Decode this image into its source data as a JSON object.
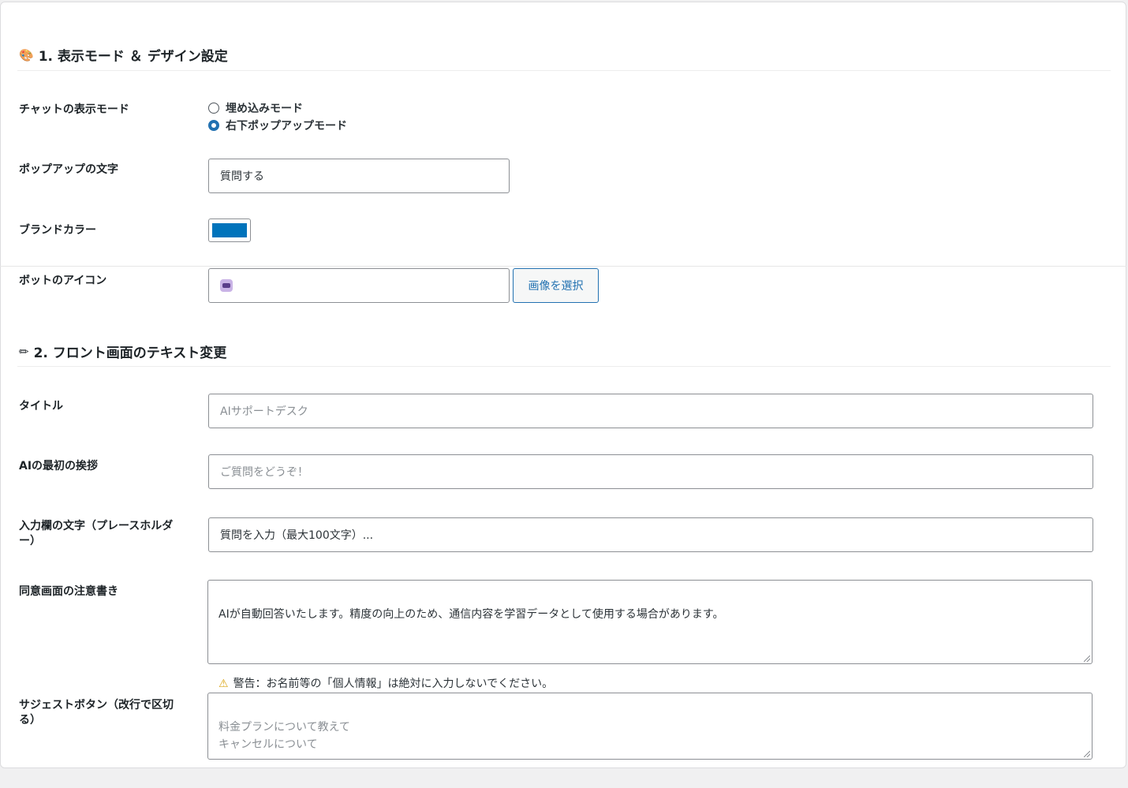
{
  "section1": {
    "icon": "palette-icon",
    "title": "1. 表示モード ＆ デザイン設定"
  },
  "display_mode": {
    "label": "チャットの表示モード",
    "options": [
      {
        "label": "埋め込みモード",
        "checked": false
      },
      {
        "label": "右下ポップアップモード",
        "checked": true
      }
    ]
  },
  "popup_text": {
    "label": "ポップアップの文字",
    "value": "質問する"
  },
  "brand_color": {
    "label": "ブランドカラー",
    "value": "#0073bb"
  },
  "bot_icon": {
    "label": "ボットのアイコン",
    "icon": "robot-icon",
    "button": "画像を選択"
  },
  "section2": {
    "icon": "pencil-icon",
    "title": "2. フロント画面のテキスト変更"
  },
  "title_field": {
    "label": "タイトル",
    "placeholder": "AIサポートデスク"
  },
  "greeting_field": {
    "label": "AIの最初の挨拶",
    "placeholder": "ご質問をどうぞ！"
  },
  "input_placeholder_field": {
    "label": "入力欄の文字（プレースホルダー）",
    "value": "質問を入力（最大100文字）..."
  },
  "consent_field": {
    "label": "同意画面の注意書き",
    "line1": "AIが自動回答いたします。精度の向上のため、通信内容を学習データとして使用する場合があります。",
    "warning_icon": "warning-icon",
    "line2": "警告：お名前等の「個人情報」は絶対に入力しないでください。"
  },
  "suggest_field": {
    "label": "サジェストボタン（改行で区切る）",
    "placeholder": "料金プランについて教えて\nキャンセルについて"
  }
}
